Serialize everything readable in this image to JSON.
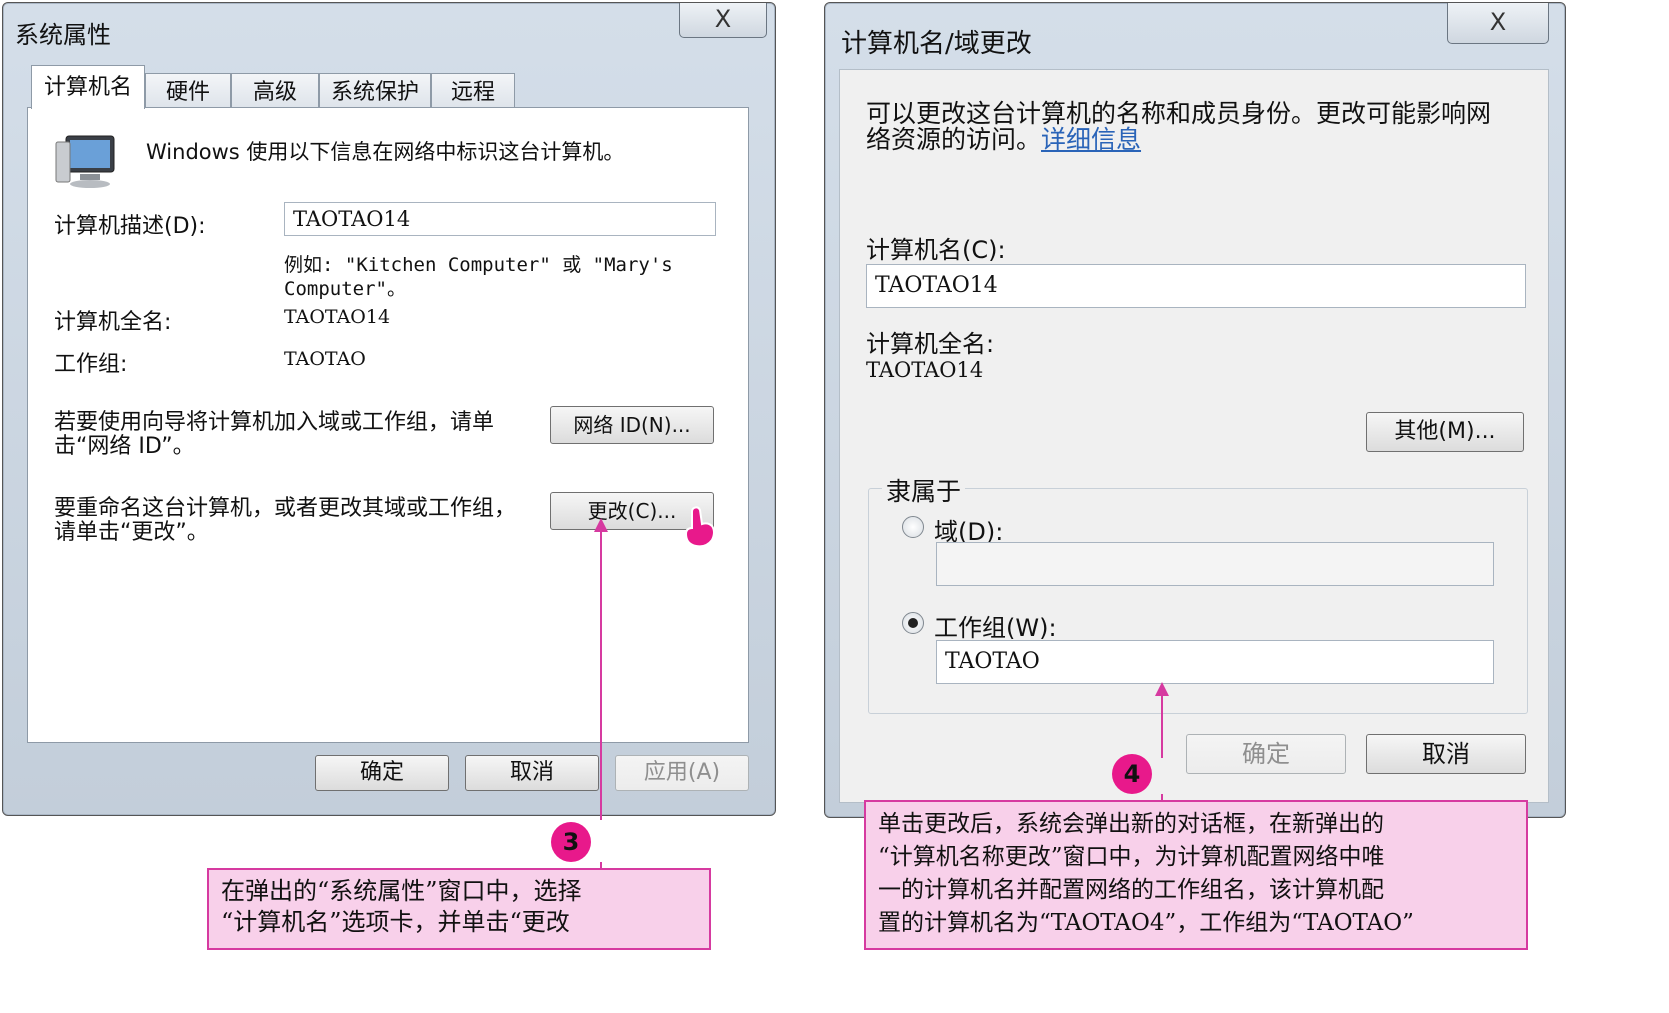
{
  "left_dialog": {
    "title": "系统属性",
    "close_glyph": "X",
    "tabs": [
      "计算机名",
      "硬件",
      "高级",
      "系统保护",
      "远程"
    ],
    "intro": "Windows 使用以下信息在网络中标识这台计算机。",
    "description_label": "计算机描述(D):",
    "description_value": "TAOTAO14",
    "example_line1": "例如: \"Kitchen Computer\" 或 \"Mary's",
    "example_line2": "Computer\"。",
    "fullname_label": "计算机全名:",
    "fullname_value": "TAOTAO14",
    "workgroup_label": "工作组:",
    "workgroup_value": "TAOTAO",
    "network_text_line1": "若要使用向导将计算机加入域或工作组，请单",
    "network_text_line2": "击“网络 ID”。",
    "network_button": "网络 ID(N)...",
    "rename_text_line1": "要重命名这台计算机，或者更改其域或工作组，",
    "rename_text_line2": "请单击“更改”。",
    "change_button": "更改(C)...",
    "ok_button": "确定",
    "cancel_button": "取消",
    "apply_button": "应用(A)"
  },
  "right_dialog": {
    "title": "计算机名/域更改",
    "close_glyph": "X",
    "intro_line1": "可以更改这台计算机的名称和成员身份。更改可能影响网",
    "intro_line2": "络资源的访问。",
    "details_link": "详细信息",
    "computer_name_label": "计算机名(C):",
    "computer_name_value": "TAOTAO14",
    "fullname_label": "计算机全名:",
    "fullname_value": "TAOTAO14",
    "other_button": "其他(M)...",
    "member_of_label": "隶属于",
    "domain_label": "域(D):",
    "domain_value": "",
    "workgroup_label": "工作组(W):",
    "workgroup_value": "TAOTAO",
    "ok_button": "确定",
    "cancel_button": "取消"
  },
  "annotations": {
    "step3_number": "3",
    "step3_line1": "在弹出的“系统属性”窗口中，选择",
    "step3_line2": "“计算机名”选项卡，并单击“更改",
    "step4_number": "4",
    "step4_line1": "单击更改后，系统会弹出新的对话框，在新弹出的",
    "step4_line2": "“计算机名称更改”窗口中，为计算机配置网络中唯",
    "step4_line3": "一的计算机名并配置网络的工作组名，该计算机配",
    "step4_line4": "置的计算机名为“TAOTAO4”，工作组为“TAOTAO”"
  },
  "colors": {
    "annotation_fill": "#f8d0ea",
    "annotation_border": "#d63aa0",
    "badge": "#e8198b",
    "cursor": "#e8198b"
  }
}
